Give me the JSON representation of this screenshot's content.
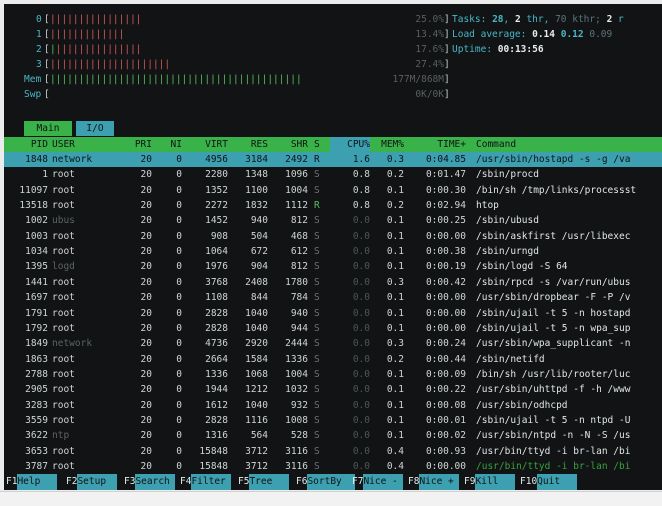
{
  "meters": {
    "cpu": [
      {
        "label": "0",
        "bars": "||||||||||||||||",
        "value": "25.0%"
      },
      {
        "label": "1",
        "bars": "|||||||||||||",
        "value": "13.4%"
      },
      {
        "label": "2",
        "bars": "|||||||||||||||",
        "value": "17.6%"
      },
      {
        "label": "3",
        "bars": "|||||||||||||||||||||",
        "value": "27.4%"
      }
    ],
    "mem": {
      "label": "Mem",
      "bars": "||||||||||||||||||||||||||||||||||||||||||||",
      "value": "177M/868M"
    },
    "swp": {
      "label": "Swp",
      "bars": "",
      "value": "0K/0K"
    }
  },
  "summary": {
    "tasks_label": "Tasks:",
    "tasks_count": "28",
    "tasks_sep": ",",
    "threads": "2",
    "threads_label": "thr,",
    "kthr": "70 kthr;",
    "running": "2",
    "running_suffix": "r",
    "load_label": "Load average:",
    "load1": "0.14",
    "load5": "0.12",
    "load15": "0.09",
    "uptime_label": "Uptime:",
    "uptime": "00:13:56"
  },
  "tabs": [
    {
      "label": "Main"
    },
    {
      "label": "I/O"
    }
  ],
  "columns": {
    "pid": "PID",
    "user": "USER",
    "pri": "PRI",
    "ni": "NI",
    "virt": "VIRT",
    "res": "RES",
    "shr": "SHR",
    "s": "S",
    "cpu": "CPU%",
    "mem": "MEM%",
    "time": "TIME+",
    "command": "Command"
  },
  "processes": [
    {
      "pid": "1848",
      "user": "network",
      "pri": "20",
      "ni": "0",
      "virt": "4956",
      "res": "3184",
      "shr": "2492",
      "s": "R",
      "cpu": "1.6",
      "mem": "0.3",
      "time": "0:04.85",
      "command": "/usr/sbin/hostapd -s -g /va",
      "selected": true,
      "dimuser": false
    },
    {
      "pid": "1",
      "user": "root",
      "pri": "20",
      "ni": "0",
      "virt": "2280",
      "res": "1348",
      "shr": "1096",
      "s": "S",
      "cpu": "0.8",
      "mem": "0.2",
      "time": "0:01.47",
      "command": "/sbin/procd",
      "selected": false,
      "dimuser": false
    },
    {
      "pid": "11097",
      "user": "root",
      "pri": "20",
      "ni": "0",
      "virt": "1352",
      "res": "1100",
      "shr": "1004",
      "s": "S",
      "cpu": "0.8",
      "mem": "0.1",
      "time": "0:00.30",
      "command": "/bin/sh /tmp/links/processst",
      "selected": false,
      "dimuser": false
    },
    {
      "pid": "13518",
      "user": "root",
      "pri": "20",
      "ni": "0",
      "virt": "2272",
      "res": "1832",
      "shr": "1112",
      "s": "R",
      "cpu": "0.8",
      "mem": "0.2",
      "time": "0:02.94",
      "command": "htop",
      "selected": false,
      "dimuser": false
    },
    {
      "pid": "1002",
      "user": "ubus",
      "pri": "20",
      "ni": "0",
      "virt": "1452",
      "res": "940",
      "shr": "812",
      "s": "S",
      "cpu": "0.0",
      "mem": "0.1",
      "time": "0:00.25",
      "command": "/sbin/ubusd",
      "selected": false,
      "dimuser": true
    },
    {
      "pid": "1003",
      "user": "root",
      "pri": "20",
      "ni": "0",
      "virt": "908",
      "res": "504",
      "shr": "468",
      "s": "S",
      "cpu": "0.0",
      "mem": "0.1",
      "time": "0:00.00",
      "command": "/sbin/askfirst /usr/libexec",
      "selected": false,
      "dimuser": false
    },
    {
      "pid": "1034",
      "user": "root",
      "pri": "20",
      "ni": "0",
      "virt": "1064",
      "res": "672",
      "shr": "612",
      "s": "S",
      "cpu": "0.0",
      "mem": "0.1",
      "time": "0:00.38",
      "command": "/sbin/urngd",
      "selected": false,
      "dimuser": false
    },
    {
      "pid": "1395",
      "user": "logd",
      "pri": "20",
      "ni": "0",
      "virt": "1976",
      "res": "904",
      "shr": "812",
      "s": "S",
      "cpu": "0.0",
      "mem": "0.1",
      "time": "0:00.19",
      "command": "/sbin/logd -S 64",
      "selected": false,
      "dimuser": true
    },
    {
      "pid": "1441",
      "user": "root",
      "pri": "20",
      "ni": "0",
      "virt": "3768",
      "res": "2408",
      "shr": "1780",
      "s": "S",
      "cpu": "0.0",
      "mem": "0.3",
      "time": "0:00.42",
      "command": "/sbin/rpcd -s /var/run/ubus",
      "selected": false,
      "dimuser": false
    },
    {
      "pid": "1697",
      "user": "root",
      "pri": "20",
      "ni": "0",
      "virt": "1108",
      "res": "844",
      "shr": "784",
      "s": "S",
      "cpu": "0.0",
      "mem": "0.1",
      "time": "0:00.00",
      "command": "/usr/sbin/dropbear -F -P /v",
      "selected": false,
      "dimuser": false
    },
    {
      "pid": "1791",
      "user": "root",
      "pri": "20",
      "ni": "0",
      "virt": "2828",
      "res": "1040",
      "shr": "940",
      "s": "S",
      "cpu": "0.0",
      "mem": "0.1",
      "time": "0:00.00",
      "command": "/sbin/ujail -t 5 -n hostapd",
      "selected": false,
      "dimuser": false
    },
    {
      "pid": "1792",
      "user": "root",
      "pri": "20",
      "ni": "0",
      "virt": "2828",
      "res": "1040",
      "shr": "944",
      "s": "S",
      "cpu": "0.0",
      "mem": "0.1",
      "time": "0:00.00",
      "command": "/sbin/ujail -t 5 -n wpa_sup",
      "selected": false,
      "dimuser": false
    },
    {
      "pid": "1849",
      "user": "network",
      "pri": "20",
      "ni": "0",
      "virt": "4736",
      "res": "2920",
      "shr": "2444",
      "s": "S",
      "cpu": "0.0",
      "mem": "0.3",
      "time": "0:00.24",
      "command": "/usr/sbin/wpa_supplicant -n",
      "selected": false,
      "dimuser": true
    },
    {
      "pid": "1863",
      "user": "root",
      "pri": "20",
      "ni": "0",
      "virt": "2664",
      "res": "1584",
      "shr": "1336",
      "s": "S",
      "cpu": "0.0",
      "mem": "0.2",
      "time": "0:00.44",
      "command": "/sbin/netifd",
      "selected": false,
      "dimuser": false
    },
    {
      "pid": "2788",
      "user": "root",
      "pri": "20",
      "ni": "0",
      "virt": "1336",
      "res": "1068",
      "shr": "1004",
      "s": "S",
      "cpu": "0.0",
      "mem": "0.1",
      "time": "0:00.09",
      "command": "/bin/sh /usr/lib/rooter/luc",
      "selected": false,
      "dimuser": false
    },
    {
      "pid": "2905",
      "user": "root",
      "pri": "20",
      "ni": "0",
      "virt": "1944",
      "res": "1212",
      "shr": "1032",
      "s": "S",
      "cpu": "0.0",
      "mem": "0.1",
      "time": "0:00.22",
      "command": "/usr/sbin/uhttpd -f -h /www",
      "selected": false,
      "dimuser": false
    },
    {
      "pid": "3283",
      "user": "root",
      "pri": "20",
      "ni": "0",
      "virt": "1612",
      "res": "1040",
      "shr": "932",
      "s": "S",
      "cpu": "0.0",
      "mem": "0.1",
      "time": "0:00.08",
      "command": "/usr/sbin/odhcpd",
      "selected": false,
      "dimuser": false
    },
    {
      "pid": "3559",
      "user": "root",
      "pri": "20",
      "ni": "0",
      "virt": "2828",
      "res": "1116",
      "shr": "1008",
      "s": "S",
      "cpu": "0.0",
      "mem": "0.1",
      "time": "0:00.01",
      "command": "/sbin/ujail -t 5 -n ntpd -U",
      "selected": false,
      "dimuser": false
    },
    {
      "pid": "3622",
      "user": "ntp",
      "pri": "20",
      "ni": "0",
      "virt": "1316",
      "res": "564",
      "shr": "528",
      "s": "S",
      "cpu": "0.0",
      "mem": "0.1",
      "time": "0:00.02",
      "command": "/usr/sbin/ntpd -n -N -S /us",
      "selected": false,
      "dimuser": true
    },
    {
      "pid": "3653",
      "user": "root",
      "pri": "20",
      "ni": "0",
      "virt": "15848",
      "res": "3712",
      "shr": "3116",
      "s": "S",
      "cpu": "0.0",
      "mem": "0.4",
      "time": "0:00.93",
      "command": "/usr/bin/ttyd -i br-lan /bi",
      "selected": false,
      "dimuser": false
    },
    {
      "pid": "3787",
      "user": "root",
      "pri": "20",
      "ni": "0",
      "virt": "15848",
      "res": "3712",
      "shr": "3116",
      "s": "S",
      "cpu": "0.0",
      "mem": "0.4",
      "time": "0:00.00",
      "command": "/usr/bin/ttyd -i br-lan /bi",
      "selected": false,
      "dimuser": false,
      "greencmd": true
    }
  ],
  "function_keys": [
    {
      "key": "F1",
      "label": "Help"
    },
    {
      "key": "F2",
      "label": "Setup"
    },
    {
      "key": "F3",
      "label": "Search"
    },
    {
      "key": "F4",
      "label": "Filter"
    },
    {
      "key": "F5",
      "label": "Tree"
    },
    {
      "key": "F6",
      "label": "SortBy"
    },
    {
      "key": "F7",
      "label": "Nice -"
    },
    {
      "key": "F8",
      "label": "Nice +"
    },
    {
      "key": "F9",
      "label": "Kill"
    },
    {
      "key": "F10",
      "label": "Quit"
    }
  ],
  "colors": {
    "background": "#111315",
    "accent_cyan": "#3ca0b0",
    "accent_green": "#39b24a",
    "cpu_bar": "#d35a5a",
    "mem_bar": "#58c05a"
  }
}
